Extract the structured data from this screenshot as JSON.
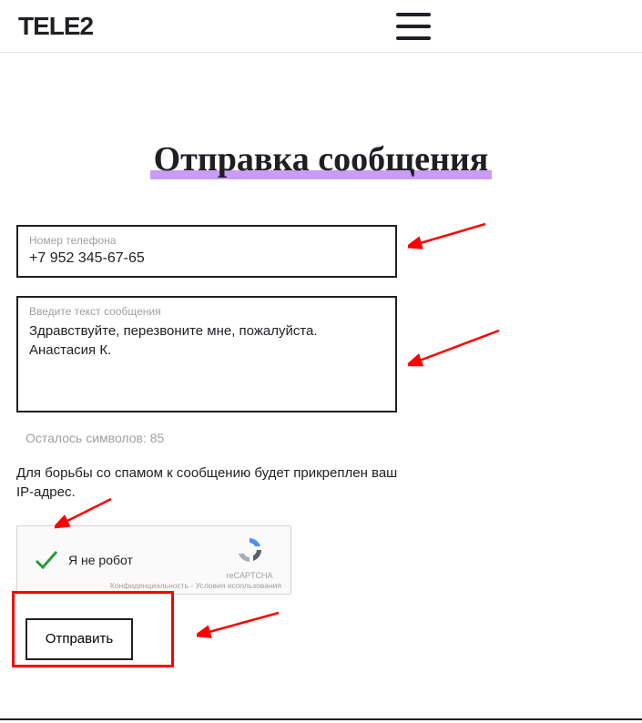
{
  "header": {
    "logo": "TELE2"
  },
  "page": {
    "title": "Отправка сообщения"
  },
  "phone": {
    "label": "Номер телефона",
    "value": "+7 952 345-67-65"
  },
  "message": {
    "label": "Введите текст сообщения",
    "value": "Здравствуйте, перезвоните мне, пожалуйста. Анастасия К."
  },
  "chars": {
    "text": "Осталось символов: 85"
  },
  "spam": {
    "text": "Для борьбы со спамом к сообщению будет прикреплен ваш IP-адрес."
  },
  "recaptcha": {
    "label": "Я не робот",
    "brand": "reCAPTCHA",
    "privacy": "Конфиденциальность - Условия использования"
  },
  "send": {
    "label": "Отправить"
  }
}
